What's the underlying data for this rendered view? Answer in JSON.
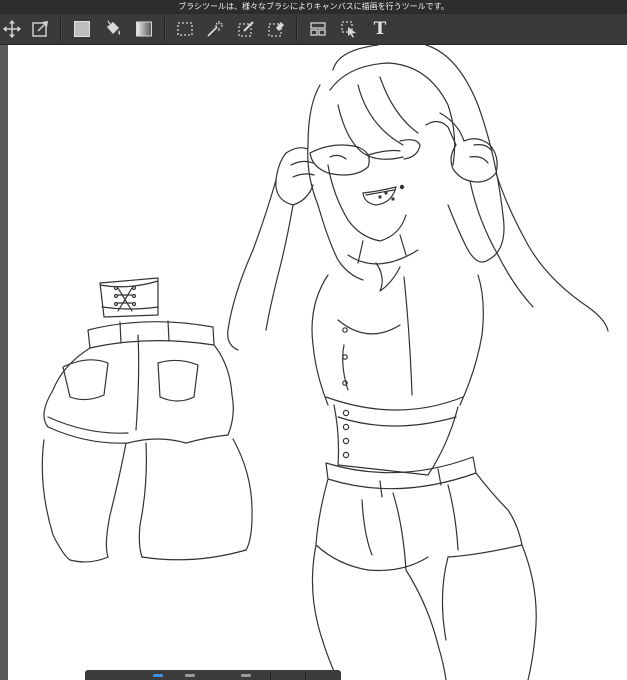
{
  "tipbar": {
    "text": "ブラシツールは、様々なブラシによりキャンバスに描画を行うツールです。"
  },
  "toolbar": {
    "text_tool_label": "T",
    "tools": [
      {
        "icon": "move-icon"
      },
      {
        "icon": "transform-icon"
      },
      {
        "icon": "fill-color-icon"
      },
      {
        "icon": "bucket-icon"
      },
      {
        "icon": "gradient-icon"
      },
      {
        "icon": "rect-select-icon"
      },
      {
        "icon": "magic-wand-icon"
      },
      {
        "icon": "select-pen-icon"
      },
      {
        "icon": "select-eraser-icon"
      },
      {
        "icon": "frame-divide-icon"
      },
      {
        "icon": "operation-icon"
      },
      {
        "icon": "text-icon"
      }
    ]
  },
  "colors": {
    "toolbar_bg": "#3a3a3a",
    "tipbar_bg": "#2c2c2c",
    "canvas_bg": "#ffffff",
    "line_art": "#333333",
    "accent": "#3d8fe0"
  },
  "canvas": {
    "content": "line-art-illustration"
  }
}
